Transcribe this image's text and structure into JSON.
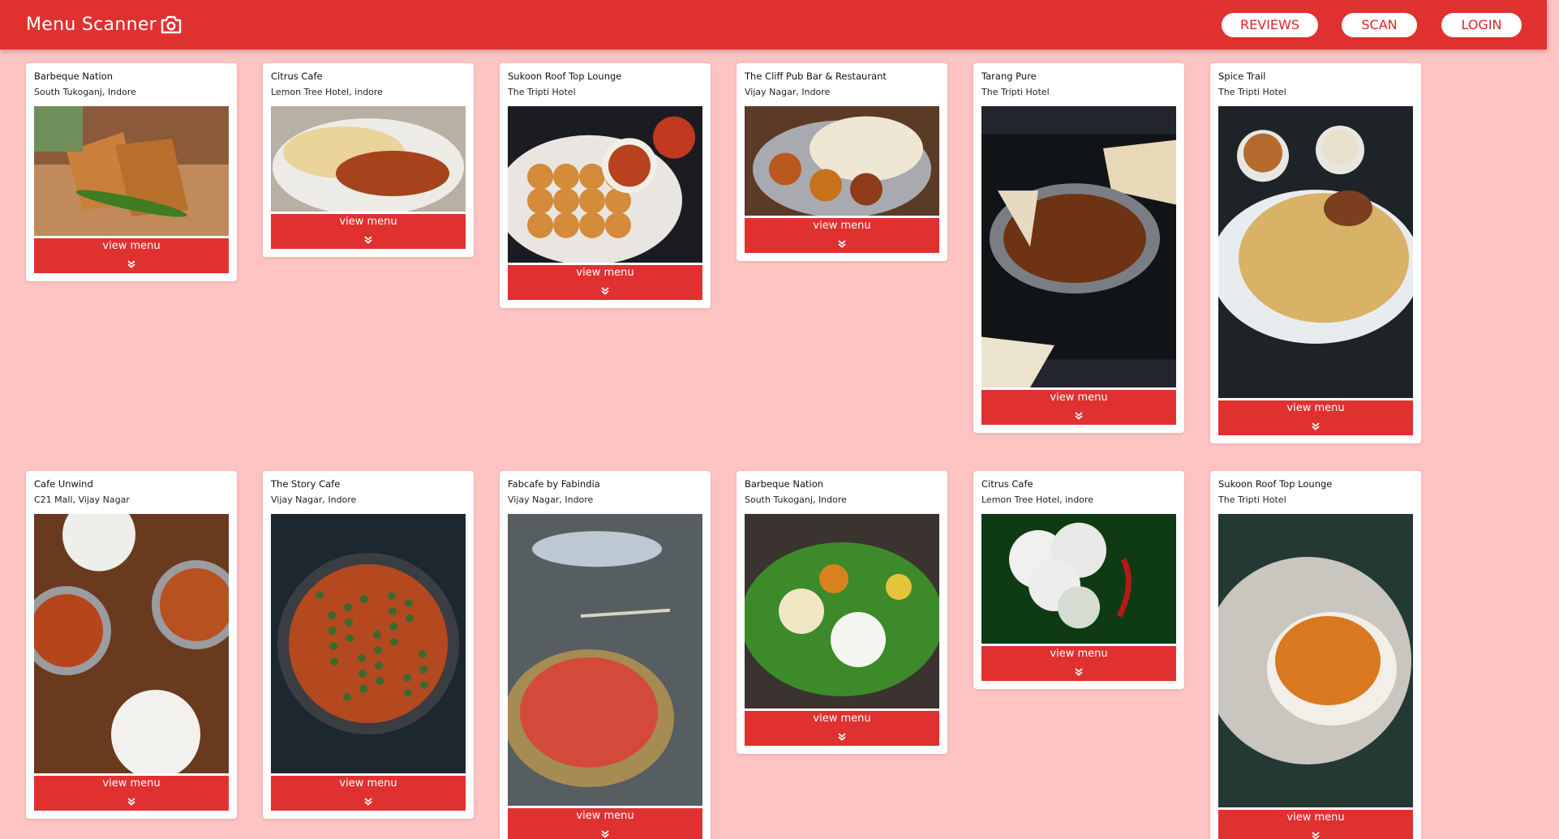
{
  "app": {
    "title": "Menu Scanner",
    "nav": {
      "reviews": "REVIEWS",
      "scan": "SCAN",
      "login": "LOGIN"
    }
  },
  "colors": {
    "primary": "#e03131",
    "background": "#fec4c4",
    "card": "#ffffff"
  },
  "view_menu_label": "view menu",
  "restaurants": [
    {
      "name": "Barbeque Nation",
      "location": "South Tukoganj, Indore",
      "photo": "samosa"
    },
    {
      "name": "Citrus Cafe",
      "location": "Lemon Tree Hotel, indore",
      "photo": "naan-curry"
    },
    {
      "name": "Sukoon Roof Top Lounge",
      "location": "The Tripti Hotel",
      "photo": "pav-bhaji"
    },
    {
      "name": "The Cliff Pub Bar & Restaurant",
      "location": "Vijay Nagar, Indore",
      "photo": "thali"
    },
    {
      "name": "Tarang Pure",
      "location": "The Tripti Hotel",
      "photo": "kadai-naan"
    },
    {
      "name": "Spice Trail",
      "location": "The Tripti Hotel",
      "photo": "biryani"
    },
    {
      "name": "Cafe Unwind",
      "location": " C21 Mall, Vijay Nagar",
      "photo": "curry-bowls"
    },
    {
      "name": "The Story Cafe",
      "location": " Vijay Nagar, Indore",
      "photo": "curry-pan"
    },
    {
      "name": "Fabcafe by Fabindia",
      "location": "Vijay Nagar, Indore",
      "photo": "halwa"
    },
    {
      "name": "Barbeque Nation",
      "location": "South Tukoganj, Indore",
      "photo": "banana-leaf-meal"
    },
    {
      "name": "Citrus Cafe",
      "location": "Lemon Tree Hotel, indore",
      "photo": "idli"
    },
    {
      "name": "Sukoon Roof Top Lounge",
      "location": "The Tripti Hotel",
      "photo": "paneer-plate"
    }
  ]
}
